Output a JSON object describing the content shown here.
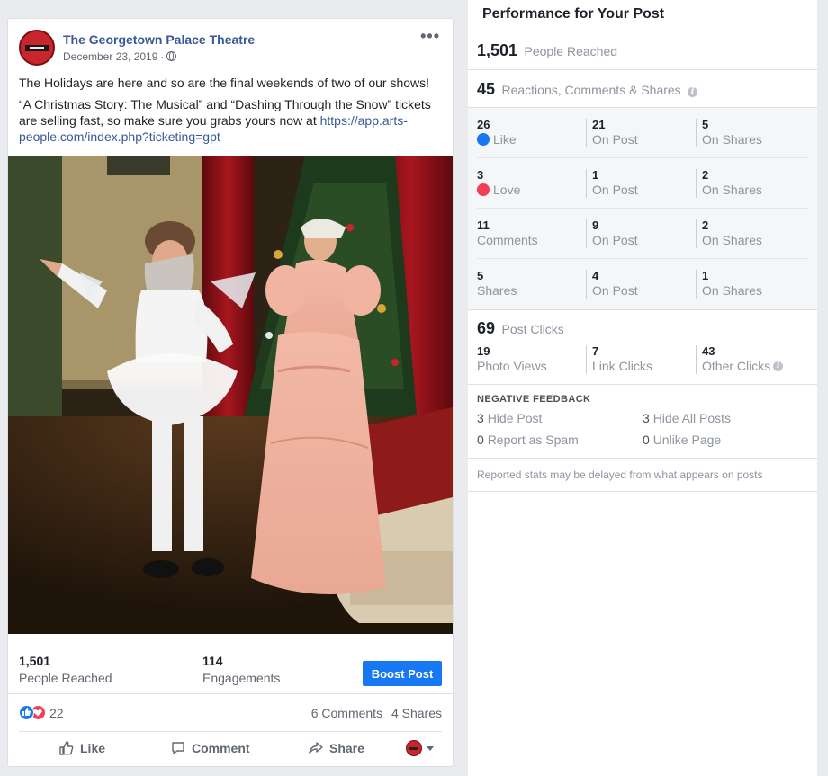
{
  "post": {
    "page_name": "The Georgetown Palace Theatre",
    "date": "December 23, 2019",
    "line1": "The Holidays are here and so are the final weekends of two of our shows!",
    "line2": "“A Christmas Story: The Musical” and “Dashing Through the Snow” tickets are selling fast, so make sure you grabs yours now at ",
    "link": "https://app.arts-people.com/index.php?ticketing=gpt",
    "people_reached_value": "1,501",
    "people_reached_label": "People Reached",
    "engagements_value": "114",
    "engagements_label": "Engagements",
    "boost_label": "Boost Post",
    "reaction_count": "22",
    "comments_text": "6 Comments",
    "shares_text": "4 Shares",
    "action_like": "Like",
    "action_comment": "Comment",
    "action_share": "Share"
  },
  "insights": {
    "title": "Performance for Your Post",
    "reached_value": "1,501",
    "reached_label": "People Reached",
    "rcs_value": "45",
    "rcs_label": "Reactions, Comments & Shares",
    "breakdown": [
      {
        "total": "26",
        "label": "Like",
        "on_post": "21",
        "on_post_label": "On Post",
        "on_shares": "5",
        "on_shares_label": "On Shares"
      },
      {
        "total": "3",
        "label": "Love",
        "on_post": "1",
        "on_post_label": "On Post",
        "on_shares": "2",
        "on_shares_label": "On Shares"
      },
      {
        "total": "11",
        "label": "Comments",
        "on_post": "9",
        "on_post_label": "On Post",
        "on_shares": "2",
        "on_shares_label": "On Shares"
      },
      {
        "total": "5",
        "label": "Shares",
        "on_post": "4",
        "on_post_label": "On Post",
        "on_shares": "1",
        "on_shares_label": "On Shares"
      }
    ],
    "clicks_value": "69",
    "clicks_label": "Post Clicks",
    "photo_views": "19",
    "photo_views_label": "Photo Views",
    "link_clicks": "7",
    "link_clicks_label": "Link Clicks",
    "other_clicks": "43",
    "other_clicks_label": "Other Clicks",
    "negative_title": "NEGATIVE FEEDBACK",
    "hide_post": "3",
    "hide_post_label": "Hide Post",
    "hide_all": "3",
    "hide_all_label": "Hide All Posts",
    "spam": "0",
    "spam_label": "Report as Spam",
    "unlike": "0",
    "unlike_label": "Unlike Page",
    "note": "Reported stats may be delayed from what appears on posts"
  },
  "colors": {
    "facebook_blue": "#1877f2",
    "link_blue": "#385898",
    "love_red": "#f33e58",
    "page_bg": "#e9ebee"
  }
}
